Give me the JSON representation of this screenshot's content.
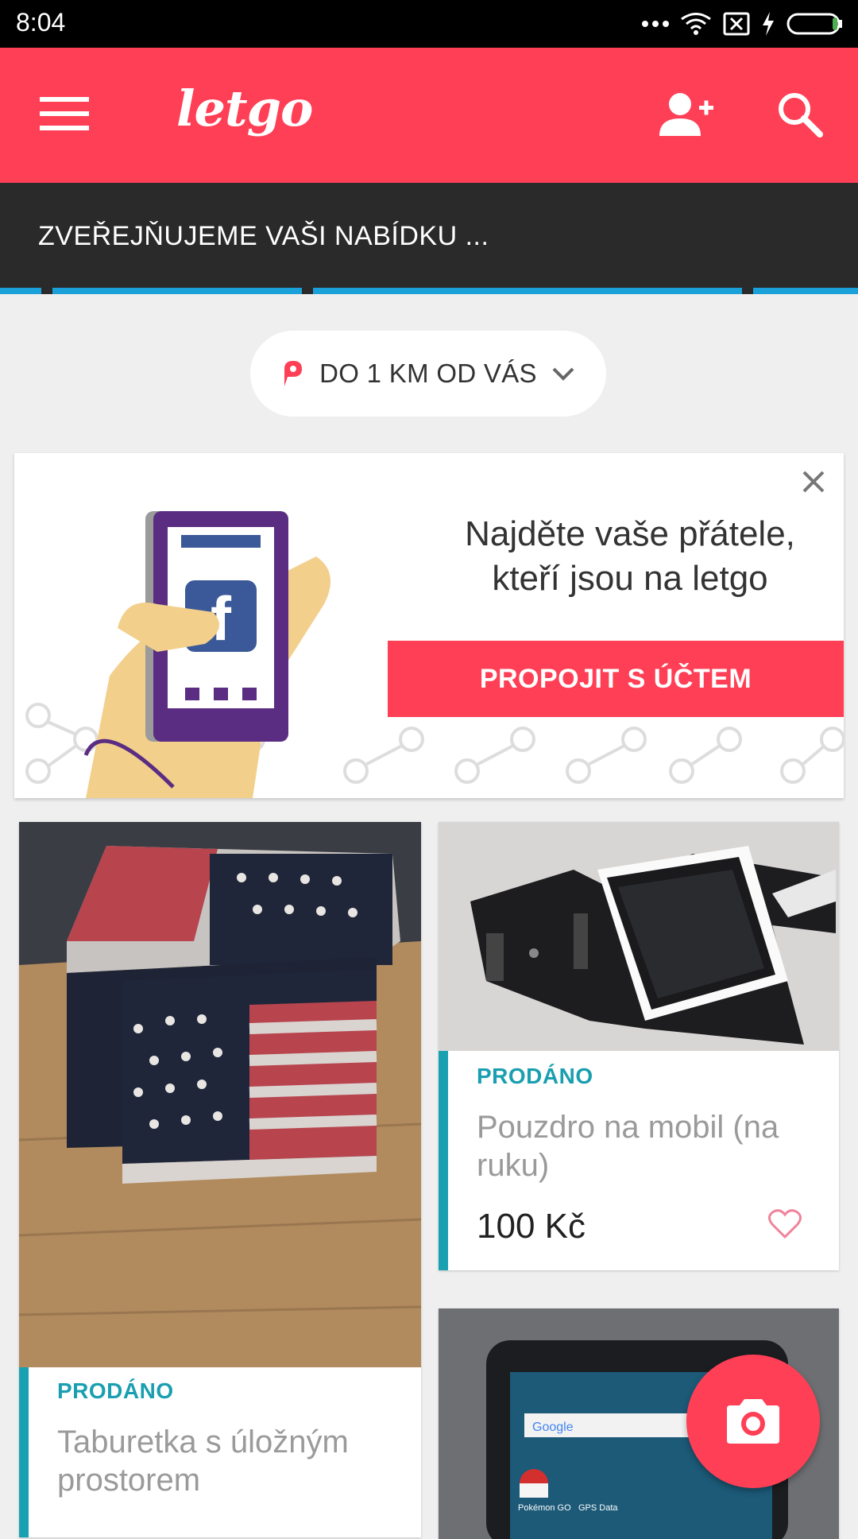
{
  "status_bar": {
    "time": "8:04"
  },
  "app_bar": {
    "logo": "letgo"
  },
  "posting_banner": {
    "text": "ZVEŘEJŇUJEME VAŠI NABÍDKU ..."
  },
  "distance_filter": {
    "label": "DO 1 KM OD VÁS"
  },
  "promo": {
    "headline_line1": "Najděte vaše přátele,",
    "headline_line2": "kteří jsou na letgo",
    "button_label": "PROPOJIT S ÚČTEM"
  },
  "products": [
    {
      "status": "PRODÁNO",
      "title": "Taburetka s úložným prostorem",
      "price": ""
    },
    {
      "status": "PRODÁNO",
      "title": "Pouzdro na mobil (na ruku)",
      "price": "100 Kč"
    },
    {
      "status": "",
      "title": "",
      "price": ""
    }
  ],
  "colors": {
    "brand": "#ff3f55",
    "sold": "#1a9fb0",
    "dark_banner": "#2a2a2a",
    "progress": "#1aa1d9"
  },
  "icons": [
    "menu-icon",
    "add-user-icon",
    "search-icon",
    "location-pin-icon",
    "chevron-down-icon",
    "close-icon",
    "heart-icon",
    "camera-icon",
    "wifi-icon",
    "battery-icon"
  ]
}
